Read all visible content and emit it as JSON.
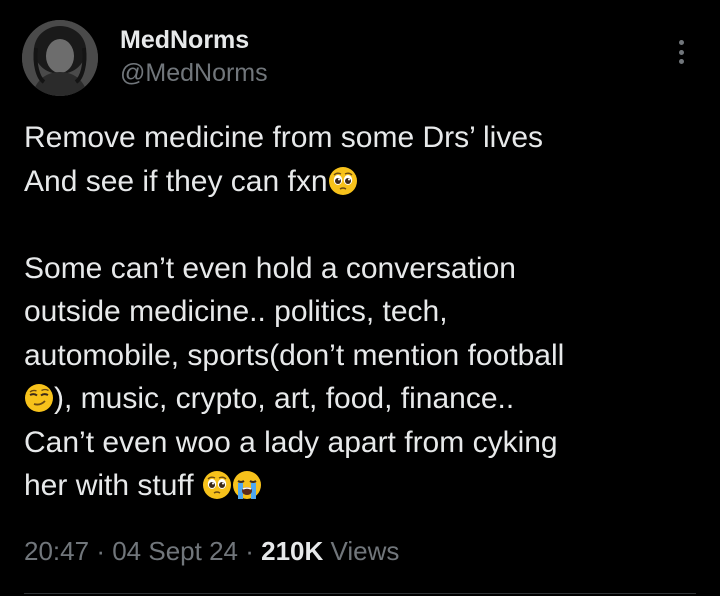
{
  "author": {
    "display_name": "MedNorms",
    "handle": "@MedNorms"
  },
  "tweet": {
    "lines": [
      "Remove medicine from some Drs’ lives",
      "And see if they can fxn",
      "Some can’t even hold a conversation",
      "outside medicine.. politics, tech,",
      "automobile, sports(don’t mention football",
      "), music, crypto, art, food, finance..",
      "Can’t even woo a lady apart from cyking",
      "her with stuff"
    ],
    "emojis": {
      "line2": "pleading-face-emoji",
      "line6": "smirking-face-emoji",
      "line8": [
        "pleading-face-emoji",
        "loudly-crying-face-emoji"
      ]
    }
  },
  "meta": {
    "time": "20:47",
    "separator": "·",
    "date": "04 Sept 24",
    "views_count": "210K",
    "views_label": "Views"
  },
  "colors": {
    "background": "#000000",
    "primary_text": "#e7e9ea",
    "secondary_text": "#71767b",
    "divider": "#2f3336"
  }
}
